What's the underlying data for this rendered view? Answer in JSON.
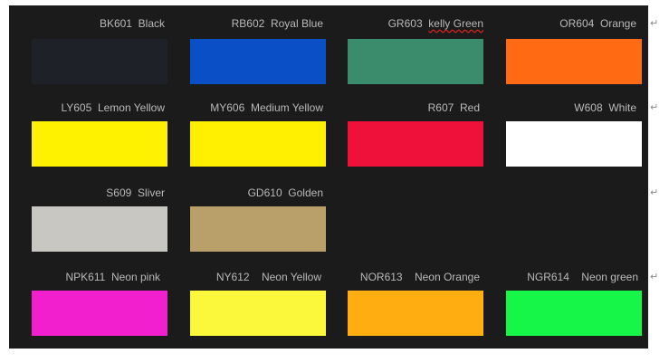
{
  "rows": [
    [
      {
        "code": "BK601",
        "name": "Black",
        "color": "#1f2128"
      },
      {
        "code": "RB602",
        "name": "Royal Blue",
        "color": "#0a4fc6"
      },
      {
        "code": "GR603",
        "name": "kelly Green",
        "name_prefix": "",
        "color": "#3a8c6c"
      },
      {
        "code": "OR604",
        "name": "Orange",
        "color": "#ff6a12"
      }
    ],
    [
      {
        "code": "LY605",
        "name": "Lemon Yellow",
        "color": "#fff200"
      },
      {
        "code": "MY606",
        "name": "Medium Yellow",
        "color": "#ffef00"
      },
      {
        "code": "R607",
        "name": "Red",
        "color": "#f0113b"
      },
      {
        "code": "W608",
        "name": "White",
        "color": "#ffffff"
      }
    ],
    [
      {
        "code": "S609",
        "name": "Sliver",
        "color": "#c9c7c2"
      },
      {
        "code": "GD610",
        "name": "Golden",
        "color": "#b9a06a"
      }
    ],
    [
      {
        "code": "NPK611",
        "name": "Neon pink",
        "color": "#f21fcf"
      },
      {
        "code": "NY612",
        "name": "Neon Yellow",
        "color": "#fbf83b"
      },
      {
        "code": "NOR613",
        "name": "Neon Orange",
        "color": "#ffad10"
      },
      {
        "code": "NGR614",
        "name": "Neon green",
        "color": "#16f648"
      }
    ]
  ],
  "paragraph_mark": "↵"
}
